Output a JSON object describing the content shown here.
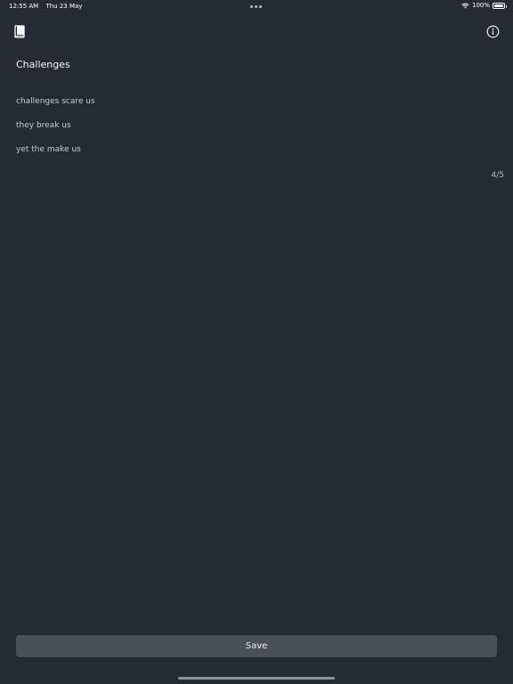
{
  "status_bar": {
    "time": "12:55 AM",
    "date": "Thu 23 May",
    "battery_text": "100%",
    "battery_level": 1.0,
    "icons": [
      "wifi-icon",
      "battery-icon"
    ]
  },
  "nav": {
    "left_icon": "book-icon",
    "right_icon": "info-icon"
  },
  "content": {
    "title": "Challenges",
    "lines": [
      "challenges scare us",
      "they break us",
      "yet the make us"
    ],
    "counter": "4/5"
  },
  "footer": {
    "save_label": "Save"
  },
  "colors": {
    "background": "#252a34",
    "button": "#4a4f58",
    "text": "#e6e8ec"
  }
}
